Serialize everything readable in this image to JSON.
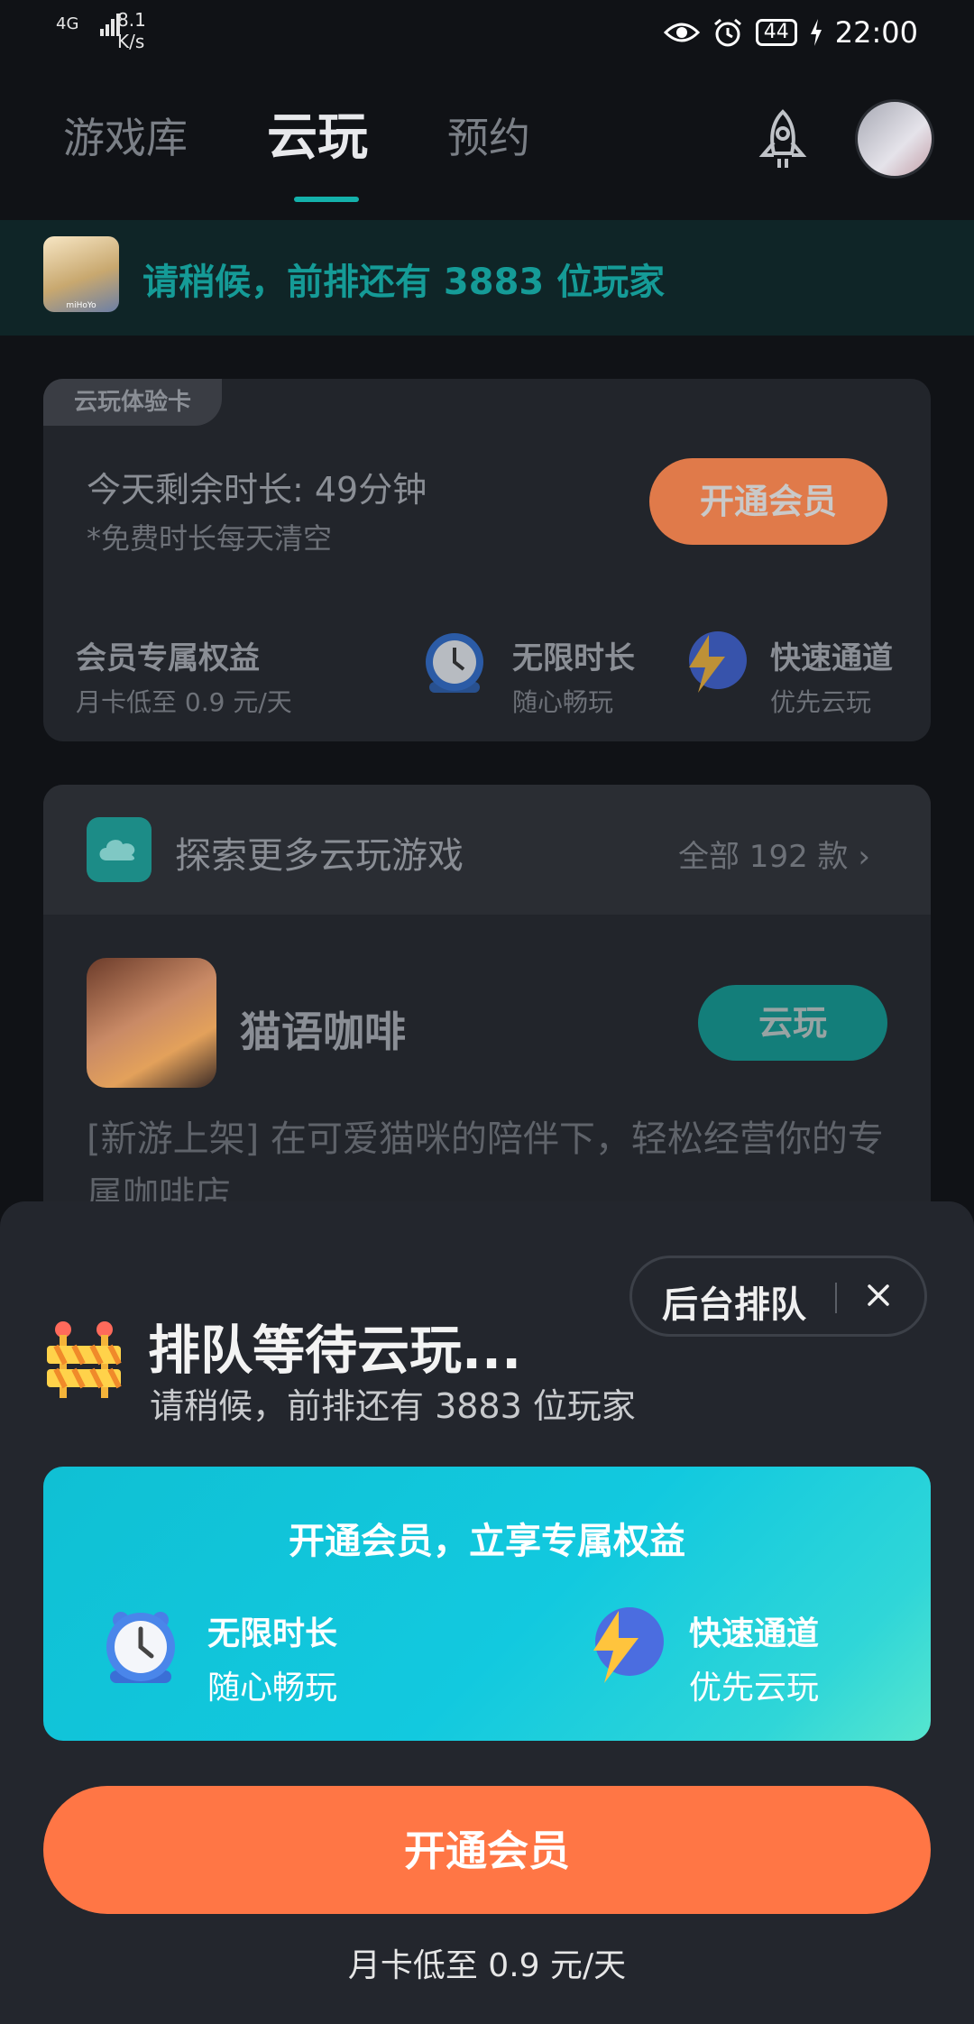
{
  "status_bar": {
    "network": "4G",
    "speed_value": "8.1",
    "speed_unit": "K/s",
    "battery": "44",
    "time": "22:00"
  },
  "nav": {
    "tabs": [
      "游戏库",
      "云玩",
      "预约"
    ],
    "active_tab": "云玩"
  },
  "queue_banner": {
    "text": "请稍候，前排还有 3883 位玩家",
    "avatar_caption": "miHoYo"
  },
  "trial_card": {
    "tag": "云玩体验卡",
    "remaining": "今天剩余时长: 49分钟",
    "note": "*免费时长每天清空",
    "button": "开通会员",
    "perks": [
      {
        "title": "会员专属权益",
        "subtitle": "月卡低至 0.9 元/天"
      },
      {
        "title": "无限时长",
        "subtitle": "随心畅玩",
        "icon": "clock-icon"
      },
      {
        "title": "快速通道",
        "subtitle": "优先云玩",
        "icon": "lightning-icon"
      }
    ]
  },
  "explore": {
    "title": "探索更多云玩游戏",
    "all_link": "全部 192 款",
    "game": {
      "name": "猫语咖啡",
      "button": "云玩",
      "description": "[新游上架] 在可爱猫咪的陪伴下，轻松经营你的专属咖啡店"
    }
  },
  "sheet": {
    "background_queue": "后台排队",
    "title": "排队等待云玩...",
    "subtitle": "请稍候，前排还有 3883 位玩家",
    "promo": {
      "title": "开通会员，立享专属权益",
      "perks": [
        {
          "title": "无限时长",
          "subtitle": "随心畅玩",
          "icon": "clock-icon"
        },
        {
          "title": "快速通道",
          "subtitle": "优先云玩",
          "icon": "lightning-icon"
        }
      ]
    },
    "cta": "开通会员",
    "price_note": "月卡低至 0.9 元/天"
  },
  "colors": {
    "accent_teal": "#14b1ab",
    "cta_orange": "#ff7645",
    "promo_cyan": "#12c9df",
    "sheet_bg": "#23262d"
  }
}
